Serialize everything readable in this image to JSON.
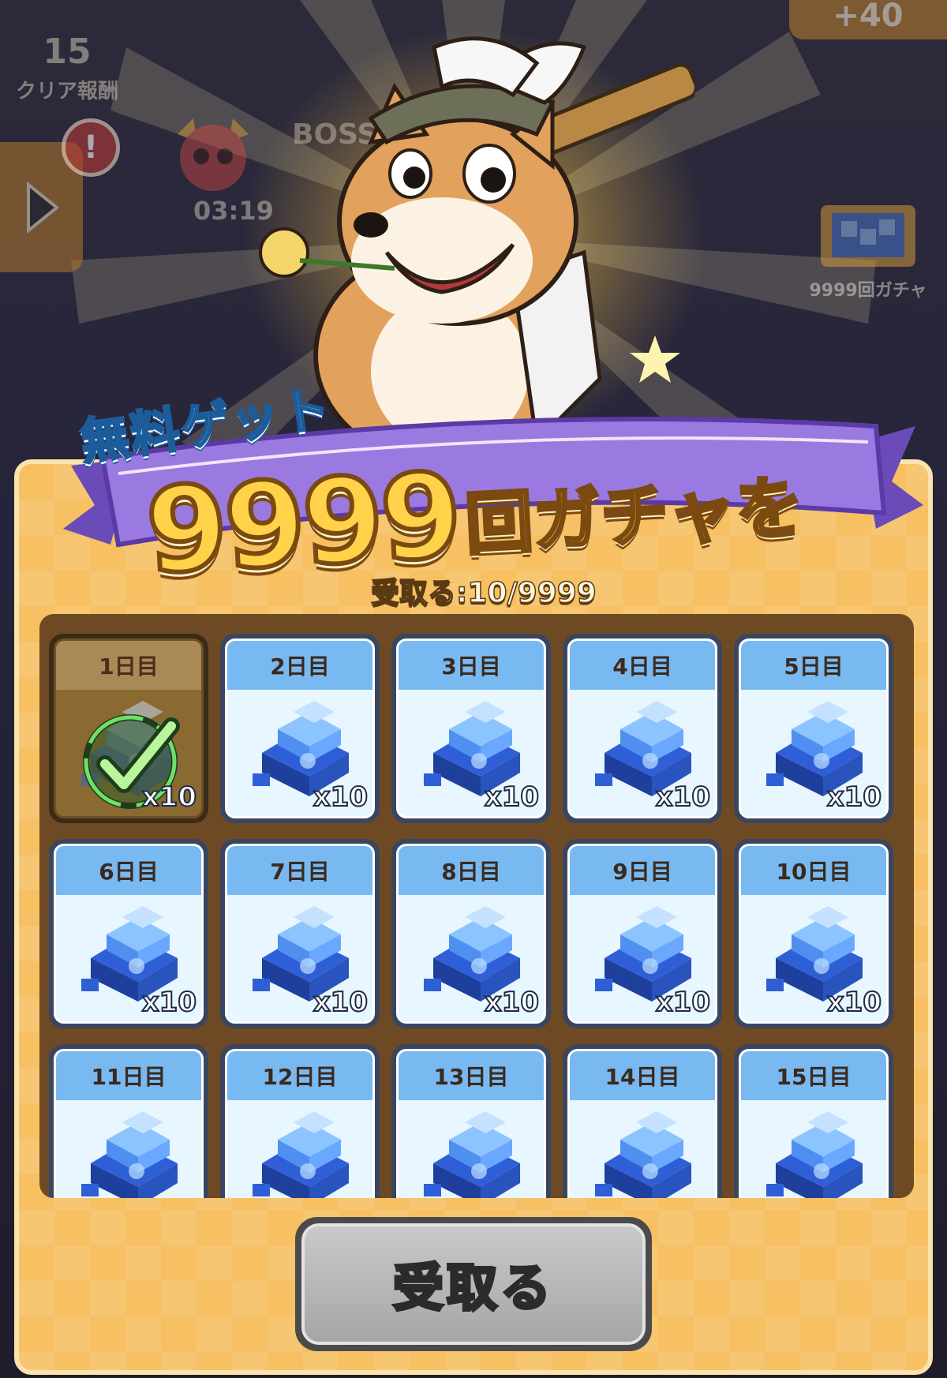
{
  "hud": {
    "coins_value": "15",
    "coins_label": "クリア報酬",
    "alert_glyph": "!",
    "boss_label": "BOSS",
    "boss_timer": "03:19",
    "plus_value": "+40",
    "gacha_shortcut_label": "9999回ガチャ"
  },
  "banner": {
    "free_label": "無料ゲット",
    "title_number": "9999",
    "title_suffix": "回ガチャを",
    "progress_text": "受取る:10/9999"
  },
  "days": [
    {
      "label": "1日目",
      "qty": "x10",
      "claimed": true
    },
    {
      "label": "2日目",
      "qty": "x10",
      "claimed": false
    },
    {
      "label": "3日目",
      "qty": "x10",
      "claimed": false
    },
    {
      "label": "4日目",
      "qty": "x10",
      "claimed": false
    },
    {
      "label": "5日目",
      "qty": "x10",
      "claimed": false
    },
    {
      "label": "6日目",
      "qty": "x10",
      "claimed": false
    },
    {
      "label": "7日目",
      "qty": "x10",
      "claimed": false
    },
    {
      "label": "8日目",
      "qty": "x10",
      "claimed": false
    },
    {
      "label": "9日目",
      "qty": "x10",
      "claimed": false
    },
    {
      "label": "10日目",
      "qty": "x10",
      "claimed": false
    },
    {
      "label": "11日目",
      "qty": "",
      "claimed": false
    },
    {
      "label": "12日目",
      "qty": "",
      "claimed": false
    },
    {
      "label": "13日目",
      "qty": "",
      "claimed": false
    },
    {
      "label": "14日目",
      "qty": "",
      "claimed": false
    },
    {
      "label": "15日目",
      "qty": "",
      "claimed": false
    }
  ],
  "claim_button": {
    "label": "受取る"
  },
  "colors": {
    "panel": "#f6c063",
    "card_header": "#79b9f1",
    "banner_ribbon": "#9a7ae0",
    "claim_button": "#a6a6a6"
  },
  "icons": {
    "reward": "blue-gem-icon",
    "claimed": "check-circle-icon"
  }
}
